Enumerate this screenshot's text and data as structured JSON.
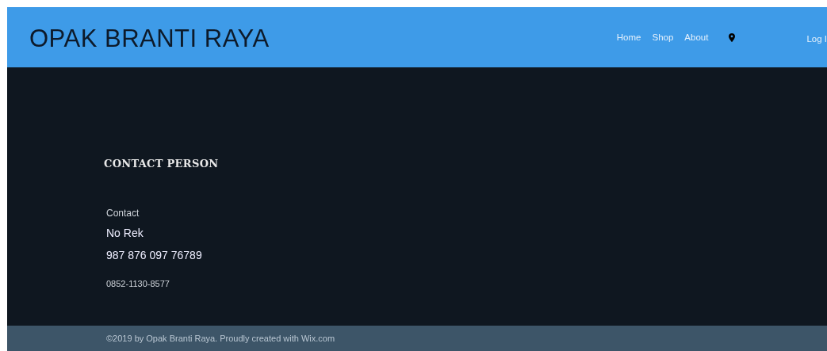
{
  "header": {
    "logo": "OPAK BRANTI RAYA",
    "nav": [
      "Home",
      "Shop",
      "About"
    ],
    "login": "Log I"
  },
  "contact": {
    "heading": "CONTACT PERSON",
    "label": "Contact",
    "account_label": "No Rek",
    "account_number": "987 876 097 76789",
    "phone": "0852-1130-8577"
  },
  "footer": {
    "text": "©2019 by Opak Branti Raya. Proudly created with Wix.com"
  }
}
